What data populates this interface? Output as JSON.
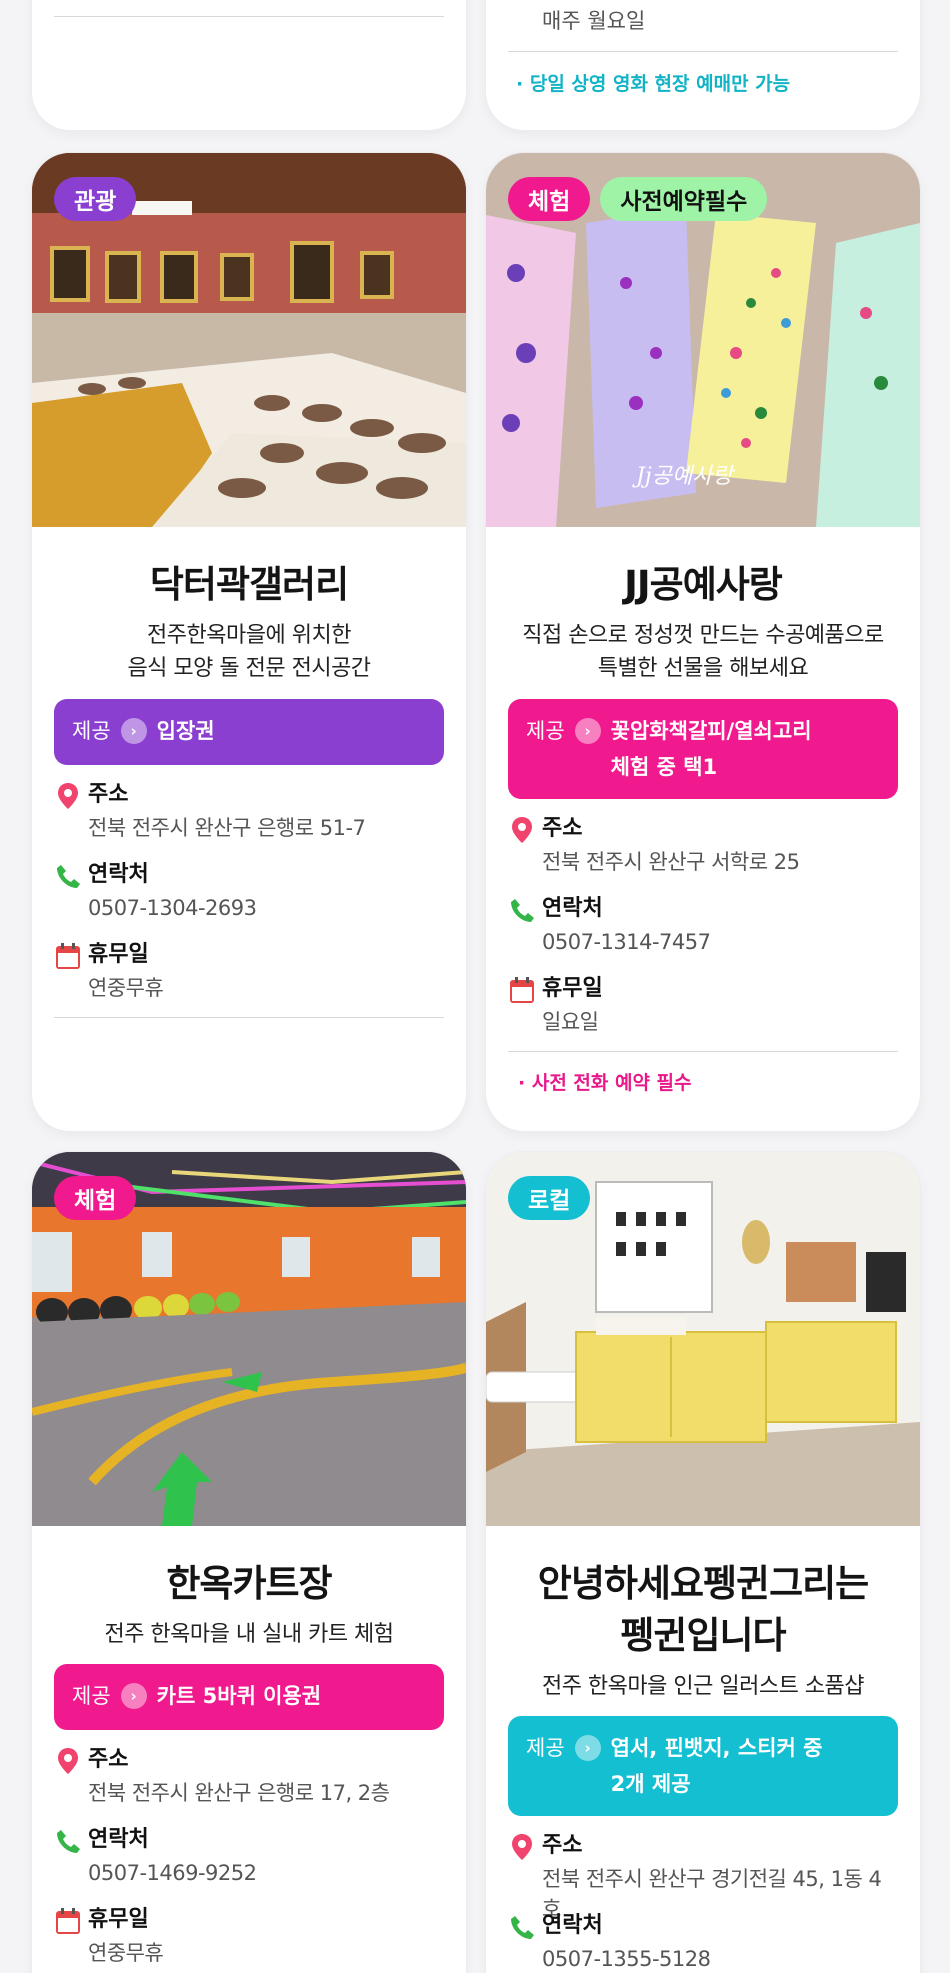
{
  "labels": {
    "offer": "제공",
    "address": "주소",
    "contact": "연락처",
    "closed": "휴무일"
  },
  "top_cards": {
    "left": {},
    "right": {
      "closed_value": "매주 월요일",
      "note": "· 당일 상영 영화 현장 예매만 가능"
    }
  },
  "cards": [
    {
      "badges": [
        "관광"
      ],
      "title": "닥터곽갤러리",
      "desc_line1": "전주한옥마을에 위치한",
      "desc_line2": "음식 모양 돌 전문 전시공간",
      "offer_line1": "입장권",
      "address": "전북 전주시 완산구 은행로 51-7",
      "contact": "0507-1304-2693",
      "closed": "연중무휴"
    },
    {
      "badges": [
        "체험",
        "사전예약필수"
      ],
      "title": "JJ공예사랑",
      "desc_line1": "직접 손으로 정성껏 만드는 수공예품으로",
      "desc_line2": "특별한 선물을 해보세요",
      "offer_line1": "꽃압화책갈피/열쇠고리",
      "offer_line2": "체험 중 택1",
      "address": "전북 전주시 완산구 서학로 25",
      "contact": "0507-1314-7457",
      "closed": "일요일",
      "note": "· 사전 전화 예약 필수",
      "photo_caption": "Jj공예사랑"
    },
    {
      "badges": [
        "체험"
      ],
      "title": "한옥카트장",
      "desc_line1": "전주 한옥마을 내 실내 카트 체험",
      "offer_line1": "카트 5바퀴 이용권",
      "address": "전북 전주시 완산구 은행로 17, 2층",
      "contact": "0507-1469-9252",
      "closed": "연중무휴"
    },
    {
      "badges": [
        "로컬"
      ],
      "title_line1": "안녕하세요펭귄그리는",
      "title_line2": "펭귄입니다",
      "desc_line1": "전주 한옥마을 인근 일러스트 소품샵",
      "offer_line1": "엽서, 핀뱃지, 스티커 중",
      "offer_line2": "2개 제공",
      "address": "전북 전주시 완산구 경기전길 45, 1동 4호",
      "contact": "0507-1355-5128"
    }
  ],
  "colors": {
    "pink": "#f0198e",
    "purple": "#8b3fd1",
    "cyan": "#15bfd2",
    "green_badge": "#9ef3a6",
    "note_cyan": "#13b3c6",
    "note_pink": "#e8188a"
  },
  "icons": [
    "location-pin-icon",
    "phone-icon",
    "calendar-icon",
    "chevron-right-icon"
  ]
}
